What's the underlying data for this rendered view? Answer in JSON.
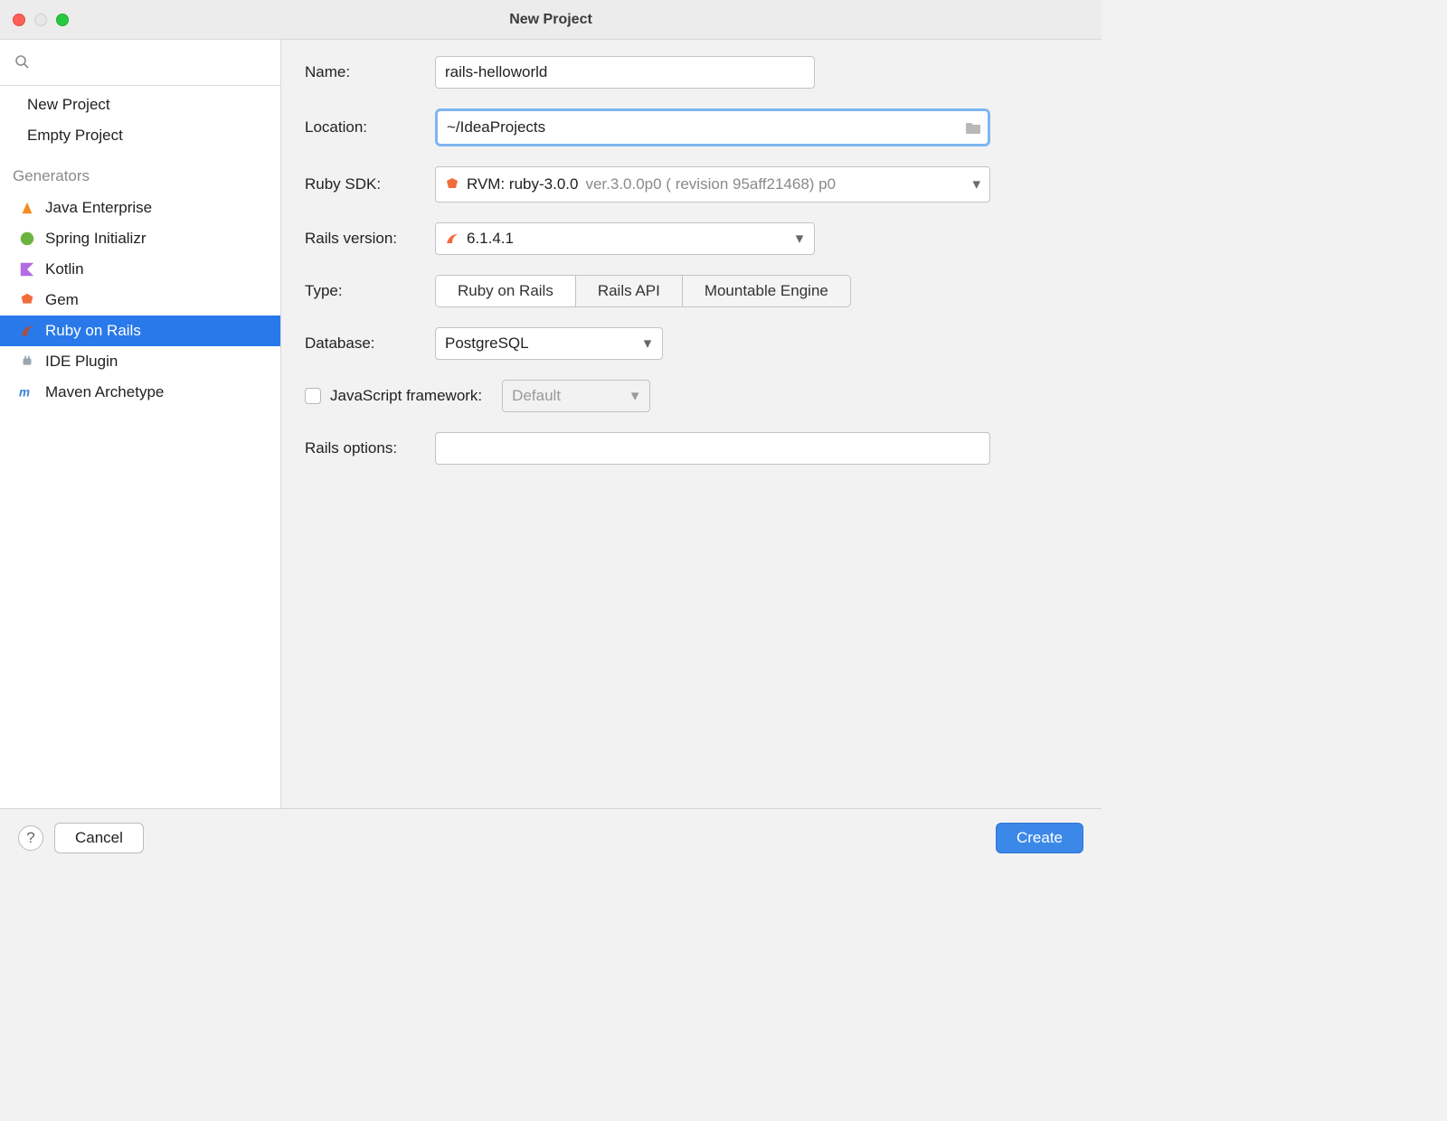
{
  "window": {
    "title": "New Project"
  },
  "sidebar": {
    "search_placeholder": "",
    "items": [
      {
        "label": "New Project"
      },
      {
        "label": "Empty Project"
      }
    ],
    "generators_header": "Generators",
    "generators": [
      {
        "label": "Java Enterprise"
      },
      {
        "label": "Spring Initializr"
      },
      {
        "label": "Kotlin"
      },
      {
        "label": "Gem"
      },
      {
        "label": "Ruby on Rails",
        "selected": true
      },
      {
        "label": "IDE Plugin"
      },
      {
        "label": "Maven Archetype"
      }
    ]
  },
  "form": {
    "name_label": "Name:",
    "name_value": "rails-helloworld",
    "location_label": "Location:",
    "location_value": "~/IdeaProjects",
    "sdk_label": "Ruby SDK:",
    "sdk_name": "RVM: ruby-3.0.0",
    "sdk_version": "ver.3.0.0p0 ( revision 95aff21468) p0",
    "rails_version_label": "Rails version:",
    "rails_version_value": "6.1.4.1",
    "type_label": "Type:",
    "type_options": [
      "Ruby on Rails",
      "Rails API",
      "Mountable Engine"
    ],
    "database_label": "Database:",
    "database_value": "PostgreSQL",
    "js_fw_label": "JavaScript framework:",
    "js_fw_value": "Default",
    "rails_options_label": "Rails options:",
    "rails_options_value": ""
  },
  "footer": {
    "help": "?",
    "cancel": "Cancel",
    "create": "Create"
  }
}
